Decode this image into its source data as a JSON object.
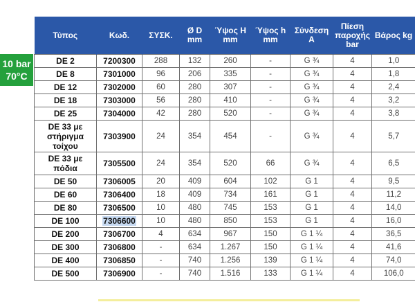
{
  "badge": {
    "line1": "10 bar",
    "line2": "70°C"
  },
  "columns": [
    "Τύπος",
    "Κωδ.",
    "ΣΥΣΚ.",
    "Ø D mm",
    "Ύψος H mm",
    "Ύψος h mm",
    "Σύνδεση A",
    "Πίεση παροχής bar",
    "Βάρος kg"
  ],
  "rows": [
    [
      "DE 2",
      "7200300",
      "288",
      "132",
      "260",
      "-",
      "G ¾",
      "4",
      "1,0"
    ],
    [
      "DE 8",
      "7301000",
      "96",
      "206",
      "335",
      "-",
      "G ¾",
      "4",
      "1,8"
    ],
    [
      "DE 12",
      "7302000",
      "60",
      "280",
      "307",
      "-",
      "G ¾",
      "4",
      "2,4"
    ],
    [
      "DE 18",
      "7303000",
      "56",
      "280",
      "410",
      "-",
      "G ¾",
      "4",
      "3,2"
    ],
    [
      "DE 25",
      "7304000",
      "42",
      "280",
      "520",
      "-",
      "G ¾",
      "4",
      "3,8"
    ],
    [
      "DE 33 με στήριγμα τοίχου",
      "7303900",
      "24",
      "354",
      "454",
      "-",
      "G ¾",
      "4",
      "5,7"
    ],
    [
      "DE 33 με πόδια",
      "7305500",
      "24",
      "354",
      "520",
      "66",
      "G ¾",
      "4",
      "6,5"
    ],
    [
      "DE 50",
      "7306005",
      "20",
      "409",
      "604",
      "102",
      "G 1",
      "4",
      "9,5"
    ],
    [
      "DE 60",
      "7306400",
      "18",
      "409",
      "734",
      "161",
      "G 1",
      "4",
      "11,2"
    ],
    [
      "DE 80",
      "7306500",
      "10",
      "480",
      "745",
      "153",
      "G 1",
      "4",
      "14,0"
    ],
    [
      "DE 100",
      "7306600",
      "10",
      "480",
      "850",
      "153",
      "G 1",
      "4",
      "16,0"
    ],
    [
      "DE 200",
      "7306700",
      "4",
      "634",
      "967",
      "150",
      "G 1 ¼",
      "4",
      "36,5"
    ],
    [
      "DE 300",
      "7306800",
      "-",
      "634",
      "1.267",
      "150",
      "G 1 ¼",
      "4",
      "41,6"
    ],
    [
      "DE 400",
      "7306850",
      "-",
      "740",
      "1.256",
      "139",
      "G 1 ¼",
      "4",
      "74,0"
    ],
    [
      "DE 500",
      "7306900",
      "-",
      "740",
      "1.516",
      "133",
      "G 1 ¼",
      "4",
      "106,0"
    ]
  ],
  "highlighted_code": "7306600",
  "colors": {
    "header_bg": "#2b58a8",
    "badge_bg": "#24a03c",
    "highlight": "#c6d9f1"
  }
}
